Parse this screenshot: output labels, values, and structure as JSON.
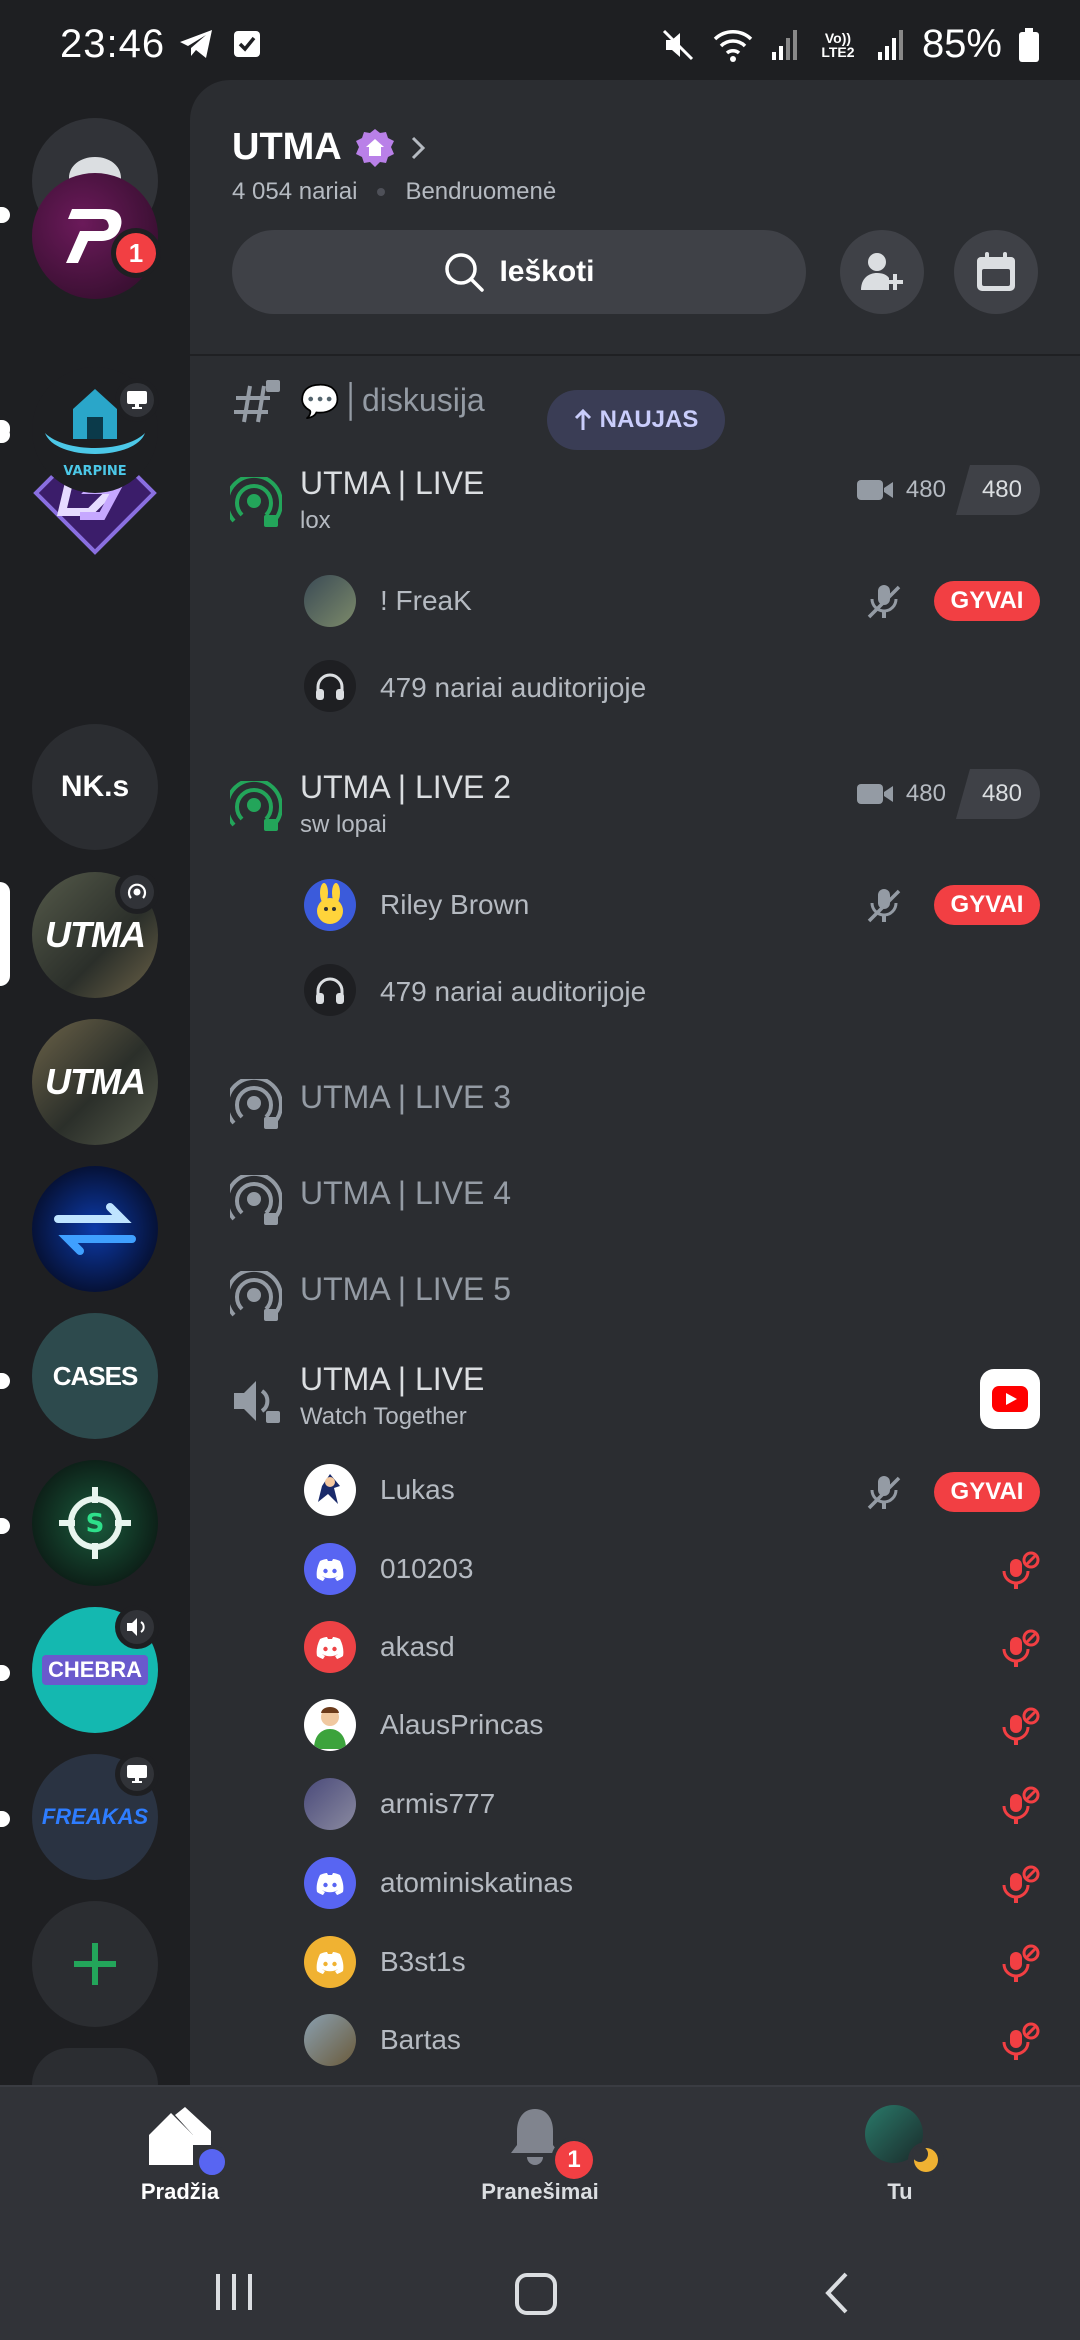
{
  "status_bar": {
    "time": "23:46",
    "network": "Vo)) LTE2",
    "battery": "85%",
    "icons": [
      "telegram-icon",
      "checkbox-icon",
      "mute-icon",
      "wifi-icon",
      "signal-icon",
      "battery-icon"
    ]
  },
  "server": {
    "name": "UTMA",
    "members": "4 054 nariai",
    "type": "Bendruomenė",
    "search_label": "Ieškoti"
  },
  "rail": {
    "servers": [
      {
        "name": "direct-messages",
        "abbr": ""
      },
      {
        "name": "server-p",
        "abbr": "",
        "badge": "1"
      },
      {
        "name": "server-ds",
        "abbr": ""
      },
      {
        "name": "server-varpine",
        "abbr": ""
      },
      {
        "name": "server-nks",
        "abbr": "NK.s"
      },
      {
        "name": "server-utma",
        "abbr": "UTMA"
      },
      {
        "name": "server-utma-2",
        "abbr": "UTMA"
      },
      {
        "name": "server-arrows",
        "abbr": ""
      },
      {
        "name": "server-cases",
        "abbr": "CASES"
      },
      {
        "name": "server-s",
        "abbr": ""
      },
      {
        "name": "server-freaku-chebra",
        "abbr": "CHEBRA"
      },
      {
        "name": "server-freakas",
        "abbr": "FREAKAS"
      }
    ]
  },
  "channels": {
    "text_channel": {
      "emoji": "💬",
      "name": "│diskusija"
    },
    "new_badge": "NAUJAS",
    "stage1": {
      "name": "UTMA | LIVE",
      "topic": "lox",
      "count": "480",
      "limit": "480",
      "speaker": "! FreaK",
      "live": "GYVAI",
      "audience": "479 nariai auditorijoje"
    },
    "stage2": {
      "name": "UTMA | LIVE 2",
      "topic": "sw lopai",
      "count": "480",
      "limit": "480",
      "speaker": "Riley Brown",
      "live": "GYVAI",
      "audience": "479 nariai auditorijoje"
    },
    "stage3": "UTMA | LIVE 3",
    "stage4": "UTMA | LIVE 4",
    "stage5": "UTMA | LIVE 5",
    "voice": {
      "name": "UTMA | LIVE",
      "topic": "Watch Together",
      "live": "GYVAI",
      "users": [
        "Lukas",
        "010203",
        "akasd",
        "AlausPrincas",
        "armis777",
        "atominiskatinas",
        "B3st1s",
        "Bartas"
      ]
    }
  },
  "bottom_nav": {
    "home": "Pradžia",
    "notifications": "Pranešimai",
    "notifications_badge": "1",
    "you": "Tu"
  },
  "colors": {
    "background": "#1e1f22",
    "panel": "#2b2d31",
    "live_red": "#f23f43",
    "stage_green": "#23a55a",
    "blurple": "#5865f2"
  }
}
